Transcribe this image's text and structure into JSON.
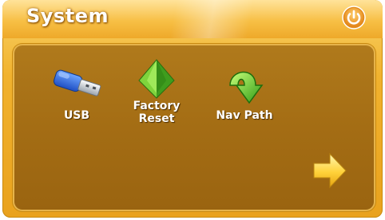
{
  "header": {
    "title": "System",
    "power_icon": "power-icon"
  },
  "menu": {
    "items": [
      {
        "label": "USB",
        "icon": "usb-drive-icon"
      },
      {
        "label": "Factory\nReset",
        "label_line1": "Factory",
        "label_line2": "Reset",
        "icon": "pyramid-icon"
      },
      {
        "label": "Nav Path",
        "icon": "curved-arrow-down-icon"
      }
    ]
  },
  "navigation": {
    "next_icon": "arrow-right-icon"
  },
  "colors": {
    "frame": "#f1b22e",
    "panel": "#a46d14",
    "accent_green": "#5cc23a",
    "arrow_yellow": "#ffd84a"
  }
}
